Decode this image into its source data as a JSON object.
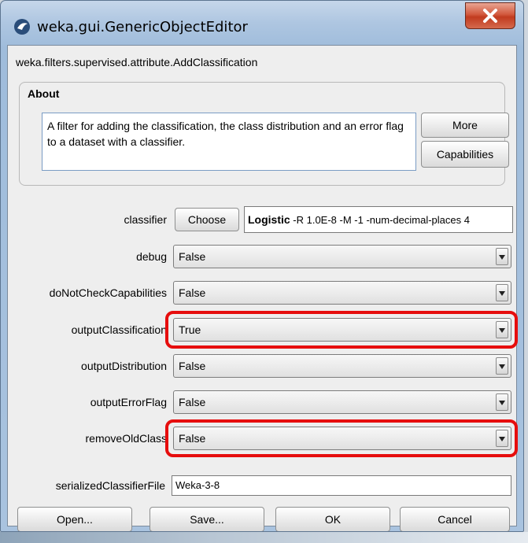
{
  "window": {
    "title": "weka.gui.GenericObjectEditor",
    "close_label": "X"
  },
  "editor": {
    "class_name": "weka.filters.supervised.attribute.AddClassification"
  },
  "about": {
    "title": "About",
    "text": "A filter for adding the classification, the class distribution and an error flag to a dataset with a classifier.",
    "more_label": "More",
    "capabilities_label": "Capabilities"
  },
  "properties": {
    "classifier": {
      "label": "classifier",
      "choose_label": "Choose",
      "name": "Logistic",
      "options": " -R 1.0E-8 -M -1 -num-decimal-places 4"
    },
    "debug": {
      "label": "debug",
      "value": "False"
    },
    "doNotCheckCapabilities": {
      "label": "doNotCheckCapabilities",
      "value": "False"
    },
    "outputClassification": {
      "label": "outputClassification",
      "value": "True"
    },
    "outputDistribution": {
      "label": "outputDistribution",
      "value": "False"
    },
    "outputErrorFlag": {
      "label": "outputErrorFlag",
      "value": "False"
    },
    "removeOldClass": {
      "label": "removeOldClass",
      "value": "False"
    },
    "serializedClassifierFile": {
      "label": "serializedClassifierFile",
      "value": "Weka-3-8"
    }
  },
  "buttons": {
    "open": "Open...",
    "save": "Save...",
    "ok": "OK",
    "cancel": "Cancel"
  },
  "colors": {
    "highlight": "#e60d0d",
    "close_button": "#c13b1f"
  },
  "icons": {
    "title": "weka-bird-icon",
    "dropdown": "chevron-down-icon"
  }
}
